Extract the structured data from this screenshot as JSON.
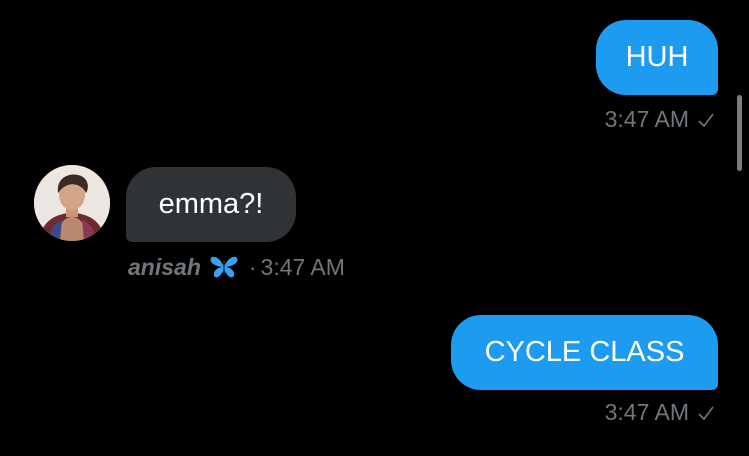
{
  "messages": [
    {
      "text": "HUH",
      "direction": "outgoing",
      "time": "3:47 AM"
    },
    {
      "text": "emma?!",
      "direction": "incoming",
      "sender": "anisah",
      "time": "3:47 AM"
    },
    {
      "text": "CYCLE CLASS",
      "direction": "outgoing",
      "time": "3:47 AM"
    }
  ],
  "incoming_meta_separator": "·",
  "sender_emoji": "butterfly-emoji",
  "colors": {
    "background": "#000000",
    "outgoing_bubble": "#1d9bf0",
    "incoming_bubble": "#2f3336",
    "meta_text": "#71767b"
  }
}
